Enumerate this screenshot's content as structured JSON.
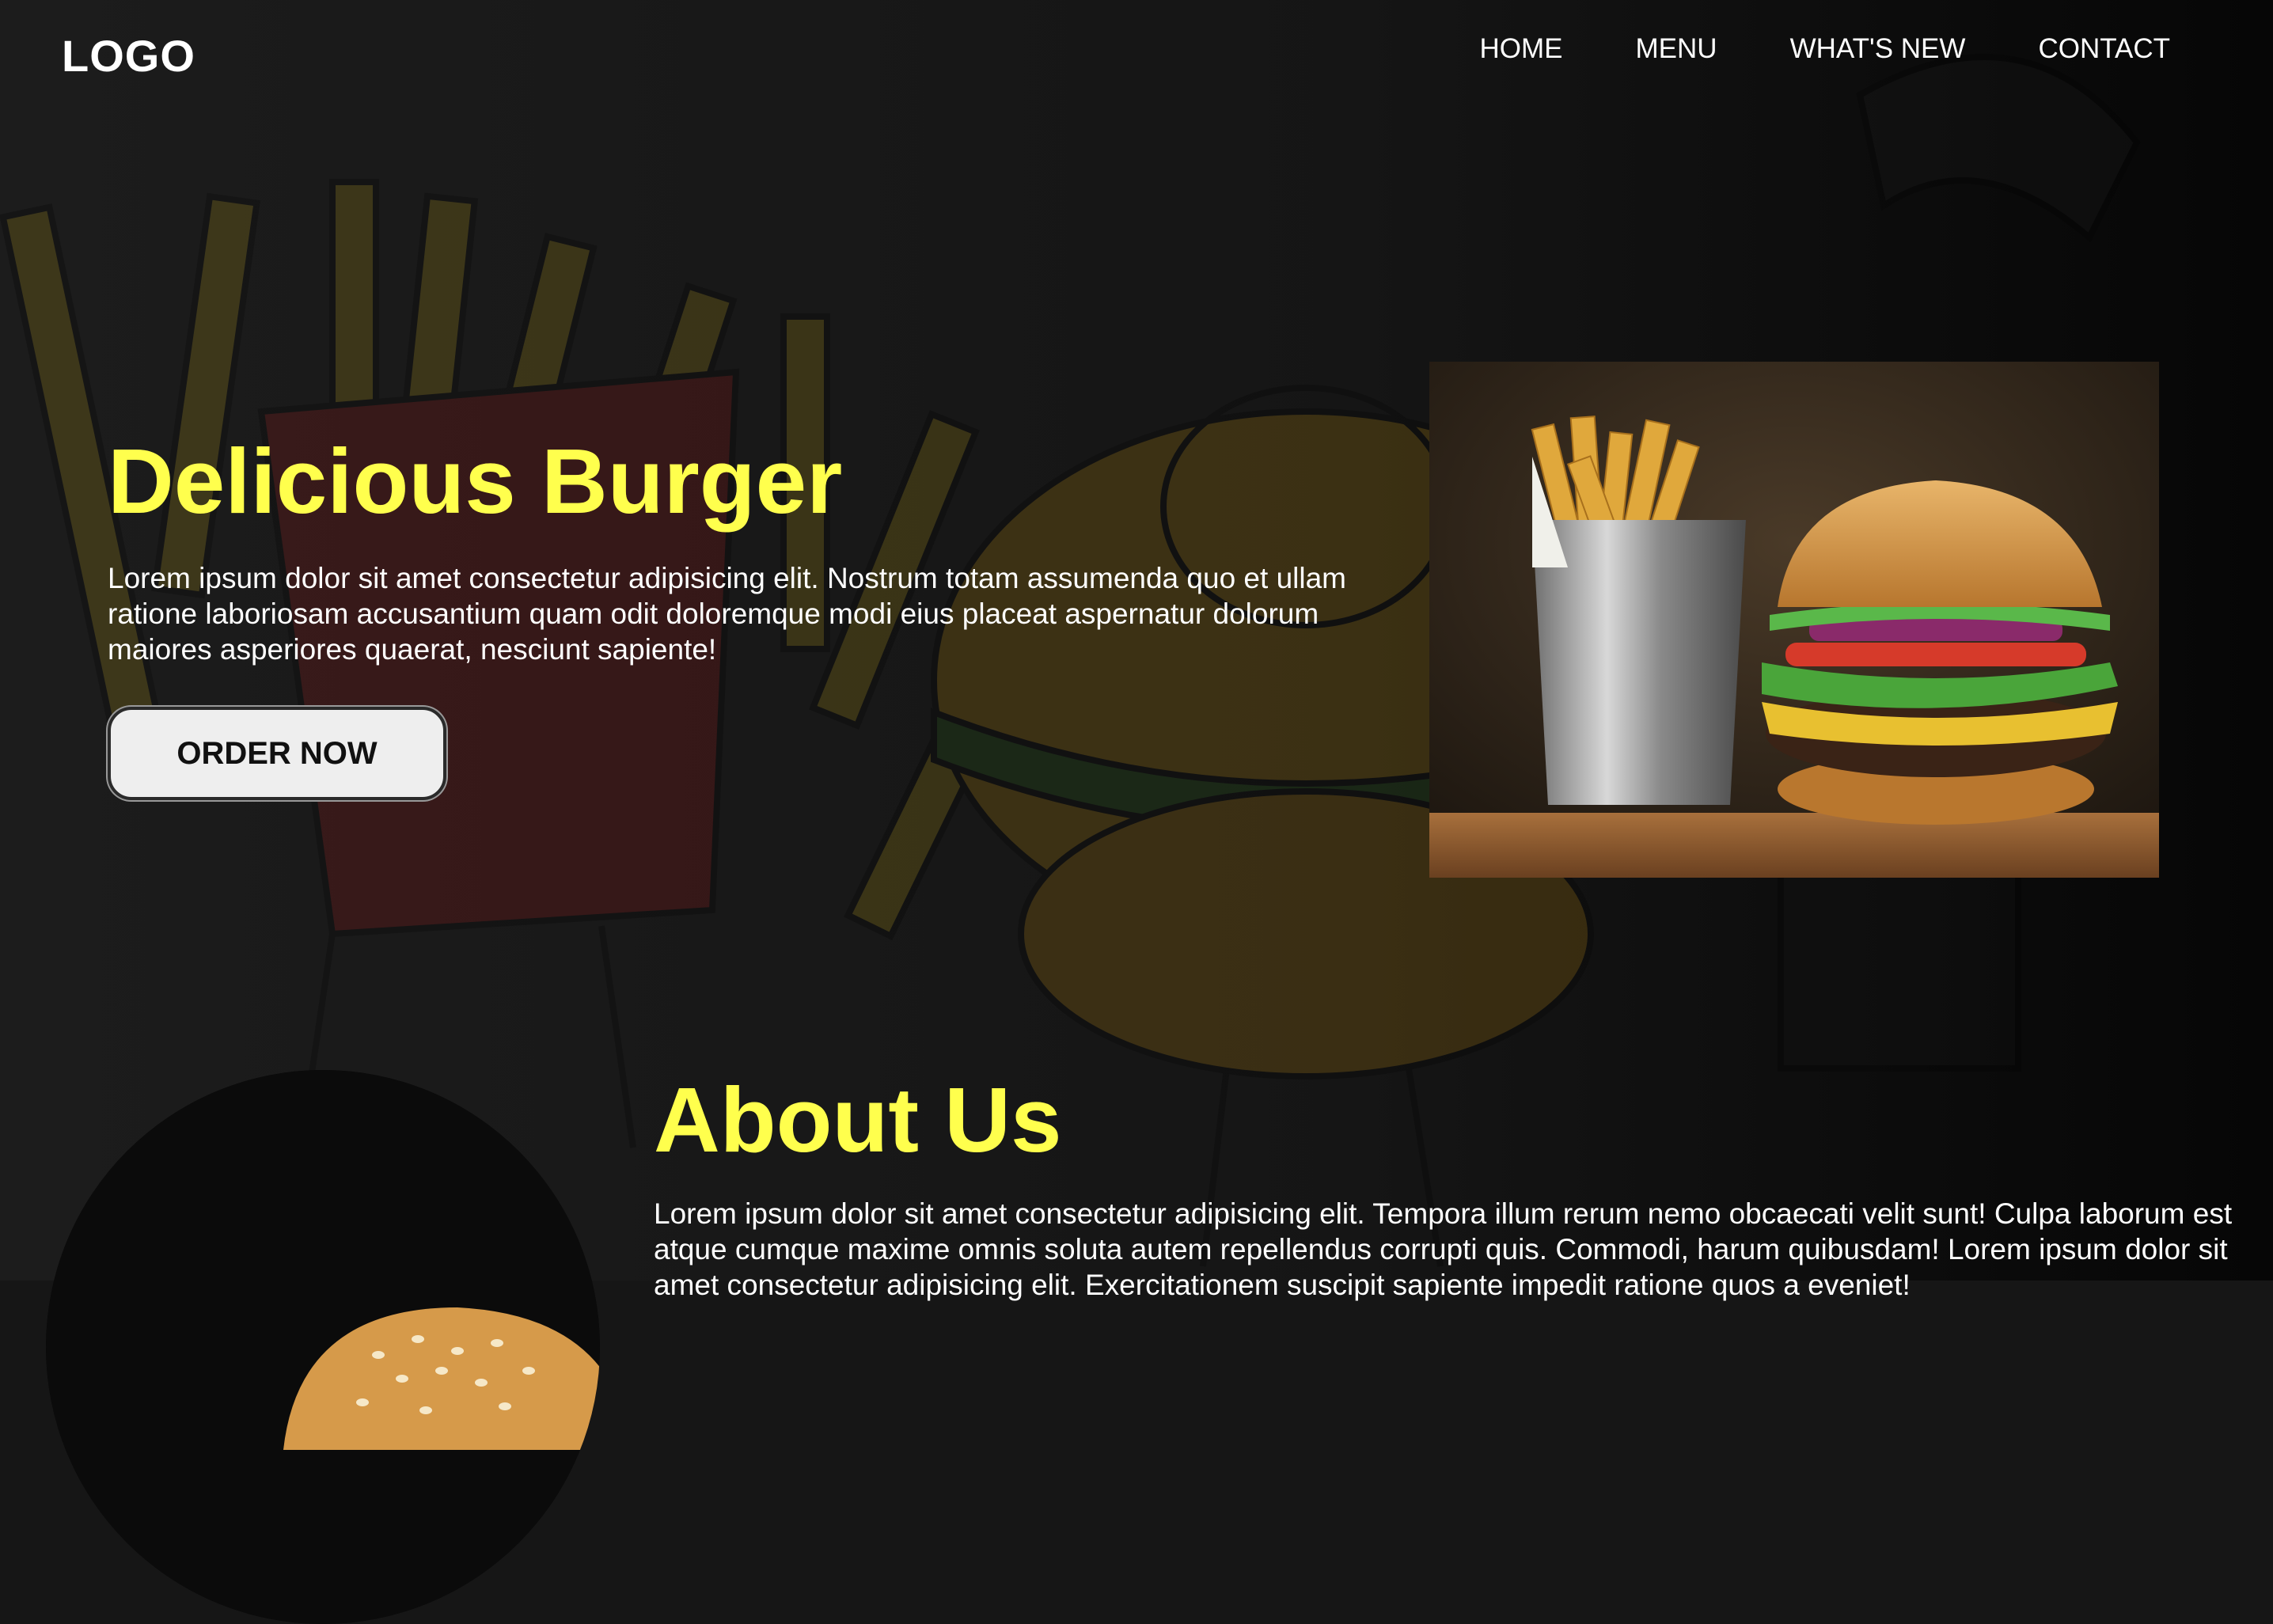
{
  "header": {
    "logo": "LOGO",
    "nav": [
      "HOME",
      "MENU",
      "WHAT'S NEW",
      "CONTACT"
    ]
  },
  "hero": {
    "title": "Delicious Burger",
    "text": "Lorem ipsum dolor sit amet consectetur adipisicing elit. Nostrum totam assumenda quo et ullam ratione laboriosam accusantium quam odit doloremque modi eius placeat aspernatur dolorum maiores asperiores quaerat, nesciunt sapiente!",
    "button": "ORDER NOW",
    "image": "burger-and-fries-photo"
  },
  "about": {
    "title": "About Us",
    "text": "Lorem ipsum dolor sit amet consectetur adipisicing elit. Tempora illum rerum nemo obcaecati velit sunt! Culpa laborum est atque cumque maxime omnis soluta autem repellendus corrupti quis. Commodi, harum quibusdam! Lorem ipsum dolor sit amet consectetur adipisicing elit. Exercitationem suscipit sapiente impedit ratione quos a eveniet!",
    "image": "burger-bun-photo"
  },
  "colors": {
    "background": "#161616",
    "accent": "#ffff4d",
    "text": "#ffffff",
    "button": "#eeeeee"
  }
}
